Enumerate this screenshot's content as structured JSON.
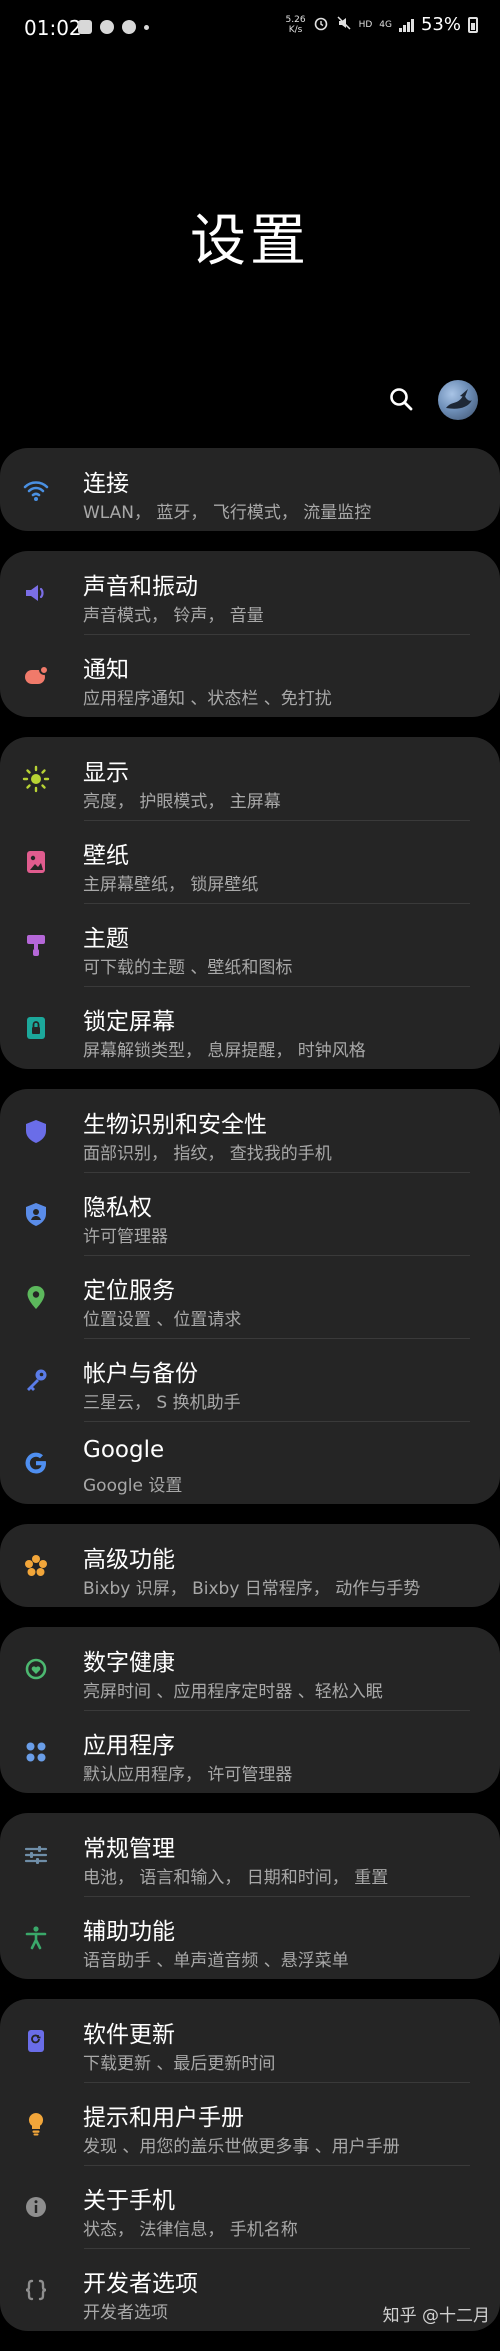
{
  "status_bar": {
    "time": "01:02",
    "speed_value": "5.26",
    "speed_unit": "K/s",
    "hd": "HD",
    "network": "4G",
    "battery": "53%"
  },
  "page_title": "设置",
  "groups": [
    {
      "items": [
        {
          "title": "连接",
          "sub": "WLAN， 蓝牙， 飞行模式， 流量监控",
          "icon": "wifi-icon",
          "color": "#4a90e2"
        }
      ]
    },
    {
      "items": [
        {
          "title": "声音和振动",
          "sub": "声音模式， 铃声， 音量",
          "icon": "volume-icon",
          "color": "#7b6ee6"
        },
        {
          "title": "通知",
          "sub": "应用程序通知 、状态栏 、免打扰",
          "icon": "notification-icon",
          "color": "#f07a6a"
        }
      ]
    },
    {
      "items": [
        {
          "title": "显示",
          "sub": "亮度， 护眼模式， 主屏幕",
          "icon": "brightness-icon",
          "color": "#b8d334"
        },
        {
          "title": "壁纸",
          "sub": "主屏幕壁纸， 锁屏壁纸",
          "icon": "wallpaper-icon",
          "color": "#e05c8e"
        },
        {
          "title": "主题",
          "sub": "可下载的主题 、壁纸和图标",
          "icon": "theme-brush-icon",
          "color": "#b567d8"
        },
        {
          "title": "锁定屏幕",
          "sub": "屏幕解锁类型， 息屏提醒， 时钟风格",
          "icon": "lock-screen-icon",
          "color": "#1ca89b"
        }
      ]
    },
    {
      "items": [
        {
          "title": "生物识别和安全性",
          "sub": "面部识别， 指纹， 查找我的手机",
          "icon": "shield-icon",
          "color": "#6a6de8"
        },
        {
          "title": "隐私权",
          "sub": "许可管理器",
          "icon": "privacy-shield-icon",
          "color": "#5a8ce8"
        },
        {
          "title": "定位服务",
          "sub": "位置设置 、位置请求",
          "icon": "location-pin-icon",
          "color": "#5cb85c"
        },
        {
          "title": "帐户与备份",
          "sub": "三星云， S 换机助手",
          "icon": "key-icon",
          "color": "#5a7ce8"
        },
        {
          "title": "Google",
          "sub": "Google 设置",
          "icon": "google-icon",
          "color": "#4f8ff0"
        }
      ]
    },
    {
      "items": [
        {
          "title": "高级功能",
          "sub": "Bixby 识屏， Bixby 日常程序， 动作与手势",
          "icon": "gear-flower-icon",
          "color": "#f2a63a"
        }
      ]
    },
    {
      "items": [
        {
          "title": "数字健康",
          "sub": "亮屏时间 、应用程序定时器 、轻松入眠",
          "icon": "digital-wellbeing-icon",
          "color": "#4cb870"
        },
        {
          "title": "应用程序",
          "sub": "默认应用程序， 许可管理器",
          "icon": "apps-grid-icon",
          "color": "#6a9ee8"
        }
      ]
    },
    {
      "items": [
        {
          "title": "常规管理",
          "sub": "电池， 语言和输入， 日期和时间， 重置",
          "icon": "sliders-icon",
          "color": "#6f8ea8"
        },
        {
          "title": "辅助功能",
          "sub": "语音助手 、单声道音频 、悬浮菜单",
          "icon": "accessibility-icon",
          "color": "#3aa86a"
        }
      ]
    },
    {
      "items": [
        {
          "title": "软件更新",
          "sub": "下载更新 、最后更新时间",
          "icon": "software-update-icon",
          "color": "#6a6de8"
        },
        {
          "title": "提示和用户手册",
          "sub": "发现 、用您的盖乐世做更多事 、用户手册",
          "icon": "lightbulb-icon",
          "color": "#f2a63a"
        },
        {
          "title": "关于手机",
          "sub": "状态， 法律信息， 手机名称",
          "icon": "info-icon",
          "color": "#8e8e8e"
        },
        {
          "title": "开发者选项",
          "sub": "开发者选项",
          "icon": "developer-braces-icon",
          "color": "#8e8e8e"
        }
      ]
    }
  ],
  "watermark": "知乎 @十二月"
}
